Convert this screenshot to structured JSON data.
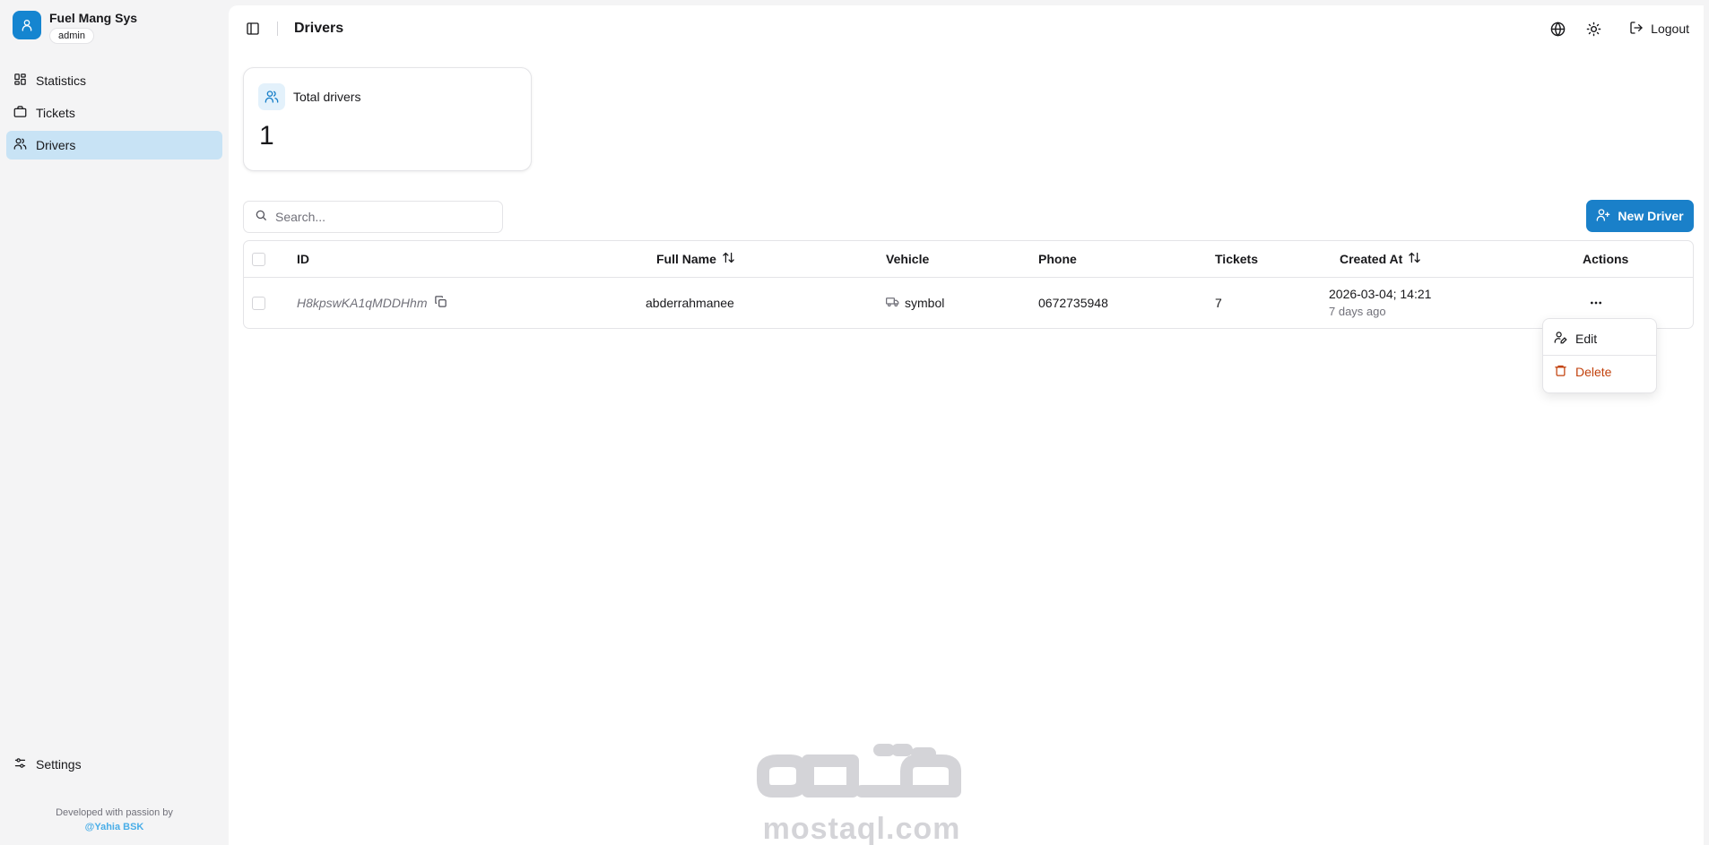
{
  "brand": {
    "title": "Fuel Mang Sys",
    "role": "admin",
    "logo_icon": "user-icon"
  },
  "sidebar": {
    "items": [
      {
        "label": "Statistics",
        "icon": "dashboard-icon"
      },
      {
        "label": "Tickets",
        "icon": "ticket-icon"
      },
      {
        "label": "Drivers",
        "icon": "users-icon",
        "active": true
      }
    ],
    "settings_label": "Settings",
    "credit_text": "Developed with passion by",
    "credit_author": "@Yahia BSK"
  },
  "topbar": {
    "title": "Drivers",
    "logout_label": "Logout",
    "icons": [
      "sidebar-toggle-icon",
      "globe-icon",
      "sun-icon",
      "logout-icon"
    ]
  },
  "stat": {
    "label": "Total drivers",
    "value": "1"
  },
  "search": {
    "placeholder": "Search..."
  },
  "new_button": {
    "label": "New Driver"
  },
  "table": {
    "columns": {
      "id": "ID",
      "full_name": "Full Name",
      "vehicle": "Vehicle",
      "phone": "Phone",
      "tickets": "Tickets",
      "created_at": "Created At",
      "actions": "Actions"
    },
    "rows": [
      {
        "id": "H8kpswKA1qMDDHhm",
        "full_name": "abderrahmanee",
        "vehicle": "symbol",
        "phone": "0672735948",
        "tickets": "7",
        "created_at": "2026-03-04; 14:21",
        "created_rel": "7 days ago"
      }
    ]
  },
  "menu": {
    "edit_label": "Edit",
    "delete_label": "Delete"
  },
  "watermark": {
    "latin": "mostaql.com"
  },
  "colors": {
    "accent": "#1a80c9",
    "active_nav": "#c8e3f5",
    "danger": "#c2410c"
  }
}
